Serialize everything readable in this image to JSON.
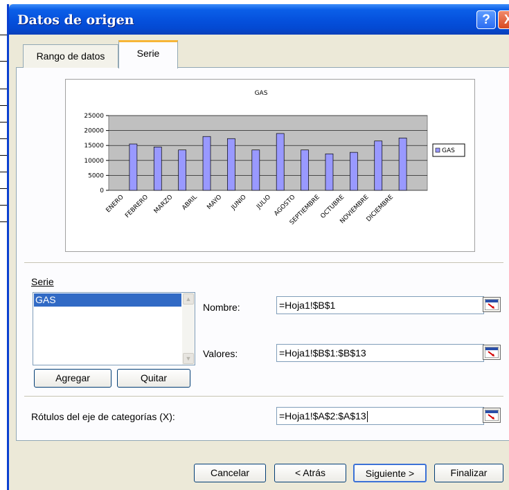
{
  "window": {
    "title": "Datos de origen",
    "help_symbol": "?",
    "close_symbol": "X"
  },
  "tabs": [
    {
      "label": "Rango de datos",
      "active": false
    },
    {
      "label": "Serie",
      "active": true
    }
  ],
  "chart_data": {
    "type": "bar",
    "title": "GAS",
    "categories": [
      "ENERO",
      "FEBRERO",
      "MARZO",
      "ABRIL",
      "MAYO",
      "JUNIO",
      "JULIO",
      "AGOSTO",
      "SEPTIEMBRE",
      "OCTUBRE",
      "NOVIEMBRE",
      "DICIEMBRE"
    ],
    "series": [
      {
        "name": "GAS",
        "values": [
          15500,
          14500,
          13500,
          18000,
          17300,
          13500,
          19000,
          13500,
          12200,
          12700,
          16500,
          17500
        ]
      }
    ],
    "yticks": [
      "25000",
      "20000",
      "15000",
      "10000",
      "5000",
      "0"
    ],
    "ylim": [
      0,
      25000
    ],
    "legend": "right",
    "grid": true,
    "plot_color": "#c0c0c0",
    "bar_color": "#9999ff"
  },
  "serie": {
    "heading": "Serie",
    "items": [
      "GAS"
    ],
    "selected": "GAS",
    "add_label": "Agregar",
    "remove_label": "Quitar"
  },
  "fields": {
    "nombre_label": "Nombre:",
    "nombre_value": "=Hoja1!$B$1",
    "valores_label": "Valores:",
    "valores_value": "=Hoja1!$B$1:$B$13",
    "rotulos_label": "Rótulos del eje de categorías (X):",
    "rotulos_value": "=Hoja1!$A$2:$A$13"
  },
  "footer": {
    "cancel": "Cancelar",
    "back": "< Atrás",
    "next": "Siguiente >",
    "finish": "Finalizar"
  }
}
